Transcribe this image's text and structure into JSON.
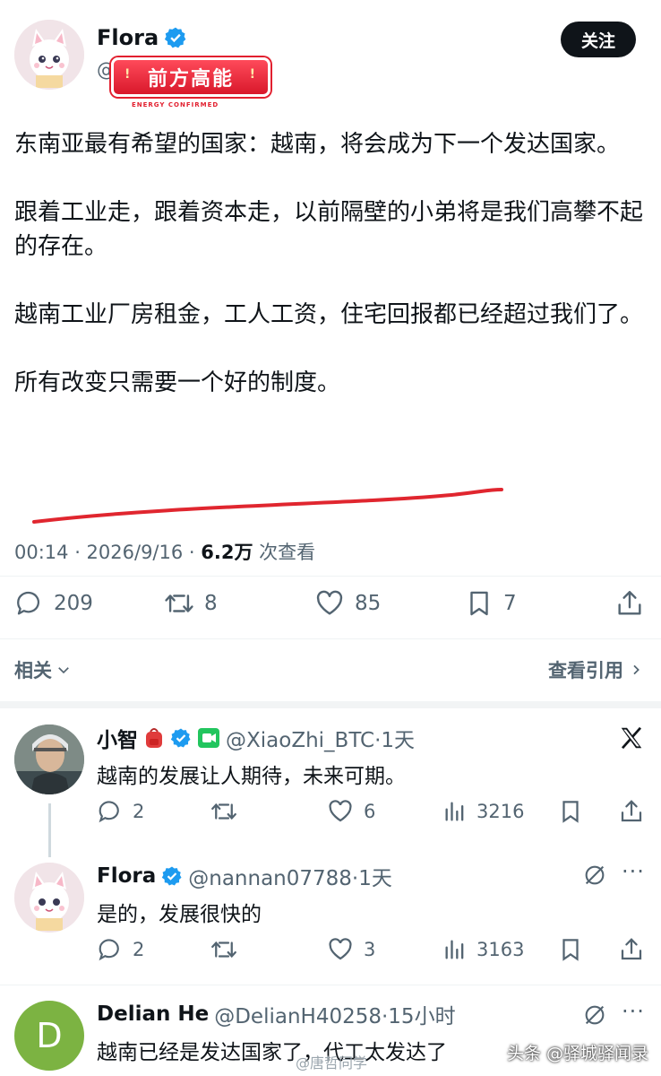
{
  "main_post": {
    "author_name": "Flora",
    "handle_fragment": "@",
    "follow_label": "关注",
    "sticker_text": "前方高能",
    "sticker_subtext": "ENERGY CONFIRMED",
    "paragraphs": [
      "东南亚最有希望的国家：越南，将会成为下一个发达国家。",
      "跟着工业走，跟着资本走，以前隔壁的小弟将是我们高攀不起的存在。",
      "越南工业厂房租金，工人工资，住宅回报都已经超过我们了。",
      "所有改变只需要一个好的制度。"
    ],
    "time": "00:14 · 2026/9/16 · ",
    "views": "6.2万",
    "views_label": " 次查看",
    "replies": "209",
    "retweets": "8",
    "likes": "85",
    "bookmarks": "7"
  },
  "related_label": "相关",
  "quotes_label": "查看引用",
  "replies": [
    {
      "name": "小智",
      "handle": "@XiaoZhi_BTC·1天",
      "text": "越南的发展让人期待，未来可期。",
      "replies": "2",
      "likes": "6",
      "views": "3216"
    },
    {
      "name": "Flora",
      "handle": "@nannan07788·1天",
      "text": "是的，发展很快的",
      "replies": "2",
      "likes": "3",
      "views": "3163"
    },
    {
      "name": "Delian He",
      "handle": "@DelianH40258·15小时",
      "text": "越南已经是发达国家了，代工太发达了",
      "avatar_letter": "D"
    }
  ],
  "watermark": "头条 @驿城驿闻录",
  "watermark_sub": "@唐哲同学",
  "colors": {
    "text": "#0f1419",
    "secondary": "#536471",
    "verified": "#1d9bf0",
    "underline": "#e0262f"
  }
}
